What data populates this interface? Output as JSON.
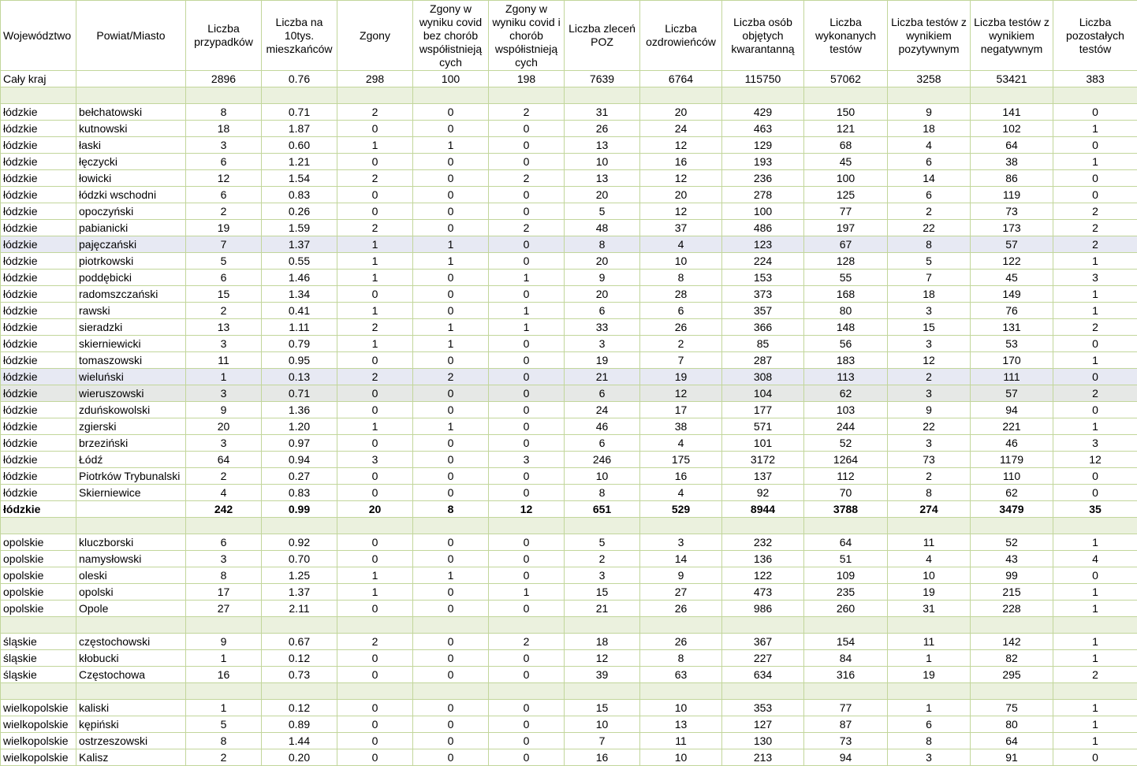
{
  "headers": [
    "Województwo",
    "Powiat/Miasto",
    "Liczba przypadków",
    "Liczba na 10tys. mieszkańców",
    "Zgony",
    "Zgony w wyniku covid bez chorób współistniejących",
    "Zgony w wyniku covid i chorób współistniejących",
    "Liczba zleceń POZ",
    "Liczba ozdrowieńców",
    "Liczba osób objętych kwarantanną",
    "Liczba wykonanych testów",
    "Liczba testów z wynikiem pozytywnym",
    "Liczba testów z wynikiem negatywnym",
    "Liczba pozostałych testów"
  ],
  "header_breaks": {
    "5": [
      "Zgony w",
      "wyniku covid",
      "bez chorób",
      "współistnieją",
      "cych"
    ],
    "6": [
      "Zgony w",
      "wyniku covid i",
      "chorób",
      "współistnieją",
      "cych"
    ]
  },
  "rows": [
    {
      "type": "total",
      "cells": [
        "Cały kraj",
        "",
        "2896",
        "0.76",
        "298",
        "100",
        "198",
        "7639",
        "6764",
        "115750",
        "57062",
        "3258",
        "53421",
        "383"
      ]
    },
    {
      "type": "sep"
    },
    {
      "type": "data",
      "cells": [
        "łódzkie",
        "bełchatowski",
        "8",
        "0.71",
        "2",
        "0",
        "2",
        "31",
        "20",
        "429",
        "150",
        "9",
        "141",
        "0"
      ]
    },
    {
      "type": "data",
      "cells": [
        "łódzkie",
        "kutnowski",
        "18",
        "1.87",
        "0",
        "0",
        "0",
        "26",
        "24",
        "463",
        "121",
        "18",
        "102",
        "1"
      ]
    },
    {
      "type": "data",
      "cells": [
        "łódzkie",
        "łaski",
        "3",
        "0.60",
        "1",
        "1",
        "0",
        "13",
        "12",
        "129",
        "68",
        "4",
        "64",
        "0"
      ]
    },
    {
      "type": "data",
      "cells": [
        "łódzkie",
        "łęczycki",
        "6",
        "1.21",
        "0",
        "0",
        "0",
        "10",
        "16",
        "193",
        "45",
        "6",
        "38",
        "1"
      ]
    },
    {
      "type": "data",
      "cells": [
        "łódzkie",
        "łowicki",
        "12",
        "1.54",
        "2",
        "0",
        "2",
        "13",
        "12",
        "236",
        "100",
        "14",
        "86",
        "0"
      ]
    },
    {
      "type": "data",
      "cells": [
        "łódzkie",
        "łódzki wschodni",
        "6",
        "0.83",
        "0",
        "0",
        "0",
        "20",
        "20",
        "278",
        "125",
        "6",
        "119",
        "0"
      ]
    },
    {
      "type": "data",
      "cells": [
        "łódzkie",
        "opoczyński",
        "2",
        "0.26",
        "0",
        "0",
        "0",
        "5",
        "12",
        "100",
        "77",
        "2",
        "73",
        "2"
      ]
    },
    {
      "type": "data",
      "cells": [
        "łódzkie",
        "pabianicki",
        "19",
        "1.59",
        "2",
        "0",
        "2",
        "48",
        "37",
        "486",
        "197",
        "22",
        "173",
        "2"
      ]
    },
    {
      "type": "hl",
      "cells": [
        "łódzkie",
        "pajęczański",
        "7",
        "1.37",
        "1",
        "1",
        "0",
        "8",
        "4",
        "123",
        "67",
        "8",
        "57",
        "2"
      ]
    },
    {
      "type": "data",
      "cells": [
        "łódzkie",
        "piotrkowski",
        "5",
        "0.55",
        "1",
        "1",
        "0",
        "20",
        "10",
        "224",
        "128",
        "5",
        "122",
        "1"
      ]
    },
    {
      "type": "data",
      "cells": [
        "łódzkie",
        "poddębicki",
        "6",
        "1.46",
        "1",
        "0",
        "1",
        "9",
        "8",
        "153",
        "55",
        "7",
        "45",
        "3"
      ]
    },
    {
      "type": "data",
      "cells": [
        "łódzkie",
        "radomszczański",
        "15",
        "1.34",
        "0",
        "0",
        "0",
        "20",
        "28",
        "373",
        "168",
        "18",
        "149",
        "1"
      ]
    },
    {
      "type": "data",
      "cells": [
        "łódzkie",
        "rawski",
        "2",
        "0.41",
        "1",
        "0",
        "1",
        "6",
        "6",
        "357",
        "80",
        "3",
        "76",
        "1"
      ]
    },
    {
      "type": "data",
      "cells": [
        "łódzkie",
        "sieradzki",
        "13",
        "1.11",
        "2",
        "1",
        "1",
        "33",
        "26",
        "366",
        "148",
        "15",
        "131",
        "2"
      ]
    },
    {
      "type": "data",
      "cells": [
        "łódzkie",
        "skierniewicki",
        "3",
        "0.79",
        "1",
        "1",
        "0",
        "3",
        "2",
        "85",
        "56",
        "3",
        "53",
        "0"
      ]
    },
    {
      "type": "data",
      "cells": [
        "łódzkie",
        "tomaszowski",
        "11",
        "0.95",
        "0",
        "0",
        "0",
        "19",
        "7",
        "287",
        "183",
        "12",
        "170",
        "1"
      ]
    },
    {
      "type": "hl",
      "cells": [
        "łódzkie",
        "wieluński",
        "1",
        "0.13",
        "2",
        "2",
        "0",
        "21",
        "19",
        "308",
        "113",
        "2",
        "111",
        "0"
      ]
    },
    {
      "type": "hl2",
      "cells": [
        "łódzkie",
        "wieruszowski",
        "3",
        "0.71",
        "0",
        "0",
        "0",
        "6",
        "12",
        "104",
        "62",
        "3",
        "57",
        "2"
      ]
    },
    {
      "type": "data",
      "cells": [
        "łódzkie",
        "zduńskowolski",
        "9",
        "1.36",
        "0",
        "0",
        "0",
        "24",
        "17",
        "177",
        "103",
        "9",
        "94",
        "0"
      ]
    },
    {
      "type": "data",
      "cells": [
        "łódzkie",
        "zgierski",
        "20",
        "1.20",
        "1",
        "1",
        "0",
        "46",
        "38",
        "571",
        "244",
        "22",
        "221",
        "1"
      ]
    },
    {
      "type": "data",
      "cells": [
        "łódzkie",
        "brzeziński",
        "3",
        "0.97",
        "0",
        "0",
        "0",
        "6",
        "4",
        "101",
        "52",
        "3",
        "46",
        "3"
      ]
    },
    {
      "type": "data",
      "cells": [
        "łódzkie",
        "Łódź",
        "64",
        "0.94",
        "3",
        "0",
        "3",
        "246",
        "175",
        "3172",
        "1264",
        "73",
        "1179",
        "12"
      ]
    },
    {
      "type": "data",
      "cells": [
        "łódzkie",
        "Piotrków Trybunalski",
        "2",
        "0.27",
        "0",
        "0",
        "0",
        "10",
        "16",
        "137",
        "112",
        "2",
        "110",
        "0"
      ]
    },
    {
      "type": "data",
      "cells": [
        "łódzkie",
        "Skierniewice",
        "4",
        "0.83",
        "0",
        "0",
        "0",
        "8",
        "4",
        "92",
        "70",
        "8",
        "62",
        "0"
      ]
    },
    {
      "type": "sum",
      "cells": [
        "łódzkie",
        "",
        "242",
        "0.99",
        "20",
        "8",
        "12",
        "651",
        "529",
        "8944",
        "3788",
        "274",
        "3479",
        "35"
      ]
    },
    {
      "type": "sep"
    },
    {
      "type": "data",
      "cells": [
        "opolskie",
        "kluczborski",
        "6",
        "0.92",
        "0",
        "0",
        "0",
        "5",
        "3",
        "232",
        "64",
        "11",
        "52",
        "1"
      ]
    },
    {
      "type": "data",
      "cells": [
        "opolskie",
        "namysłowski",
        "3",
        "0.70",
        "0",
        "0",
        "0",
        "2",
        "14",
        "136",
        "51",
        "4",
        "43",
        "4"
      ]
    },
    {
      "type": "data",
      "cells": [
        "opolskie",
        "oleski",
        "8",
        "1.25",
        "1",
        "1",
        "0",
        "3",
        "9",
        "122",
        "109",
        "10",
        "99",
        "0"
      ]
    },
    {
      "type": "data",
      "cells": [
        "opolskie",
        "opolski",
        "17",
        "1.37",
        "1",
        "0",
        "1",
        "15",
        "27",
        "473",
        "235",
        "19",
        "215",
        "1"
      ]
    },
    {
      "type": "data",
      "cells": [
        "opolskie",
        "Opole",
        "27",
        "2.11",
        "0",
        "0",
        "0",
        "21",
        "26",
        "986",
        "260",
        "31",
        "228",
        "1"
      ]
    },
    {
      "type": "sep"
    },
    {
      "type": "data",
      "cells": [
        "śląskie",
        "częstochowski",
        "9",
        "0.67",
        "2",
        "0",
        "2",
        "18",
        "26",
        "367",
        "154",
        "11",
        "142",
        "1"
      ]
    },
    {
      "type": "data",
      "cells": [
        "śląskie",
        "kłobucki",
        "1",
        "0.12",
        "0",
        "0",
        "0",
        "12",
        "8",
        "227",
        "84",
        "1",
        "82",
        "1"
      ]
    },
    {
      "type": "data",
      "cells": [
        "śląskie",
        "Częstochowa",
        "16",
        "0.73",
        "0",
        "0",
        "0",
        "39",
        "63",
        "634",
        "316",
        "19",
        "295",
        "2"
      ]
    },
    {
      "type": "sep"
    },
    {
      "type": "data",
      "cells": [
        "wielkopolskie",
        "kaliski",
        "1",
        "0.12",
        "0",
        "0",
        "0",
        "15",
        "10",
        "353",
        "77",
        "1",
        "75",
        "1"
      ]
    },
    {
      "type": "data",
      "cells": [
        "wielkopolskie",
        "kępiński",
        "5",
        "0.89",
        "0",
        "0",
        "0",
        "10",
        "13",
        "127",
        "87",
        "6",
        "80",
        "1"
      ]
    },
    {
      "type": "data",
      "cells": [
        "wielkopolskie",
        "ostrzeszowski",
        "8",
        "1.44",
        "0",
        "0",
        "0",
        "7",
        "11",
        "130",
        "73",
        "8",
        "64",
        "1"
      ]
    },
    {
      "type": "data",
      "cells": [
        "wielkopolskie",
        "Kalisz",
        "2",
        "0.20",
        "0",
        "0",
        "0",
        "16",
        "10",
        "213",
        "94",
        "3",
        "91",
        "0"
      ]
    }
  ],
  "colors": {
    "grid": "#c2d69b",
    "separator": "#ebf1de",
    "highlight": "#e7e9f3"
  }
}
